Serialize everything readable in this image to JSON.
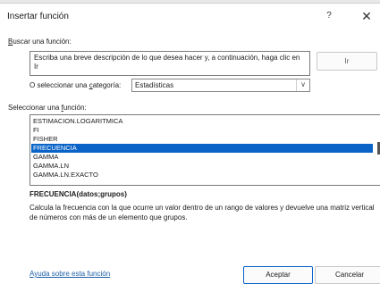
{
  "dialog": {
    "title": "Insertar función",
    "help_glyph": "?",
    "close_glyph": "✕"
  },
  "search": {
    "label": "Buscar una función:",
    "label_key": "B",
    "label_rest": "uscar una función:",
    "placeholder": "Escriba una breve descripción de lo que desea hacer y, a continuación, haga clic en Ir",
    "go_button": "Ir"
  },
  "category": {
    "label": "O seleccionar una categoría:",
    "label_before": "O seleccionar una ",
    "label_key": "c",
    "label_after": "ategoría:",
    "selected": "Estadísticas"
  },
  "functions": {
    "label_before": "Seleccionar una ",
    "label_key": "f",
    "label_after": "unción:",
    "items": [
      {
        "name": "ESTIMACION.LOGARITMICA",
        "selected": false
      },
      {
        "name": "FI",
        "selected": false
      },
      {
        "name": "FISHER",
        "selected": false
      },
      {
        "name": "FRECUENCIA",
        "selected": true
      },
      {
        "name": "GAMMA",
        "selected": false
      },
      {
        "name": "GAMMA.LN",
        "selected": false
      },
      {
        "name": "GAMMA.LN.EXACTO",
        "selected": false
      }
    ]
  },
  "details": {
    "signature": "FRECUENCIA(datos;grupos)",
    "description": "Calcula la frecuencia con la que ocurre un valor dentro de un rango de valores y devuelve una matriz vertical de números con más de un elemento que grupos."
  },
  "footer": {
    "help_link": "Ayuda sobre esta función",
    "ok_button": "Aceptar",
    "cancel_button": "Cancelar"
  },
  "colors": {
    "selection": "#0a64c8",
    "link": "#1d5fa8"
  }
}
